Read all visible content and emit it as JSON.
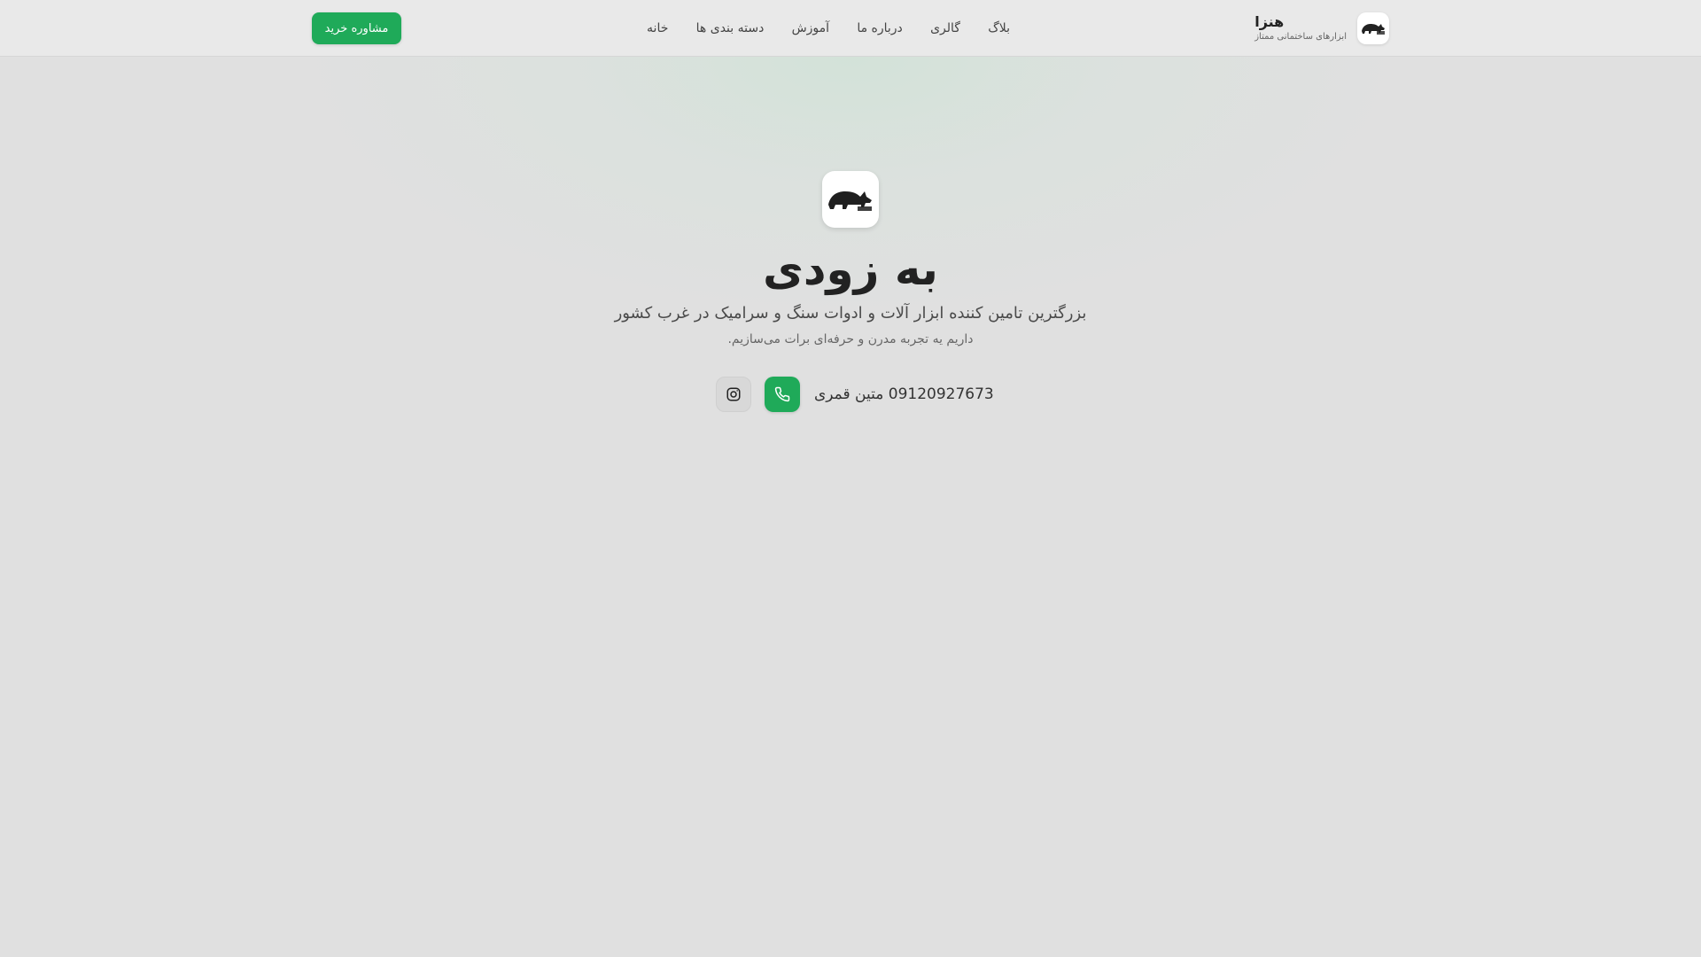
{
  "header": {
    "brand": {
      "name": "هنزا",
      "tagline": "ابزارهای ساختمانی ممتاز",
      "logo_icon": "rhino-logo-icon"
    },
    "nav": {
      "items": [
        {
          "label": "خانه"
        },
        {
          "label": "دسته بندی ها"
        },
        {
          "label": "آموزش"
        },
        {
          "label": "درباره ما"
        },
        {
          "label": "گالری"
        },
        {
          "label": "بلاگ"
        }
      ]
    },
    "cta_label": "مشاوره خرید"
  },
  "hero": {
    "logo_icon": "rhino-logo-icon",
    "title": "به زودی",
    "subtitle": "بزرگترین تامین کننده ابزار آلات و ادوات سنگ و سرامیک در غرب کشور",
    "description": "داریم یه تجربه مدرن و حرفه‌ای برات می‌سازیم.",
    "contact": {
      "text": "09120927673 متین قمری",
      "phone_icon": "phone-icon",
      "instagram_icon": "instagram-icon"
    }
  },
  "colors": {
    "accent": "#1faa59",
    "background": "#e0e0e0",
    "header_background": "#e9e9e9",
    "text": "#222222"
  }
}
